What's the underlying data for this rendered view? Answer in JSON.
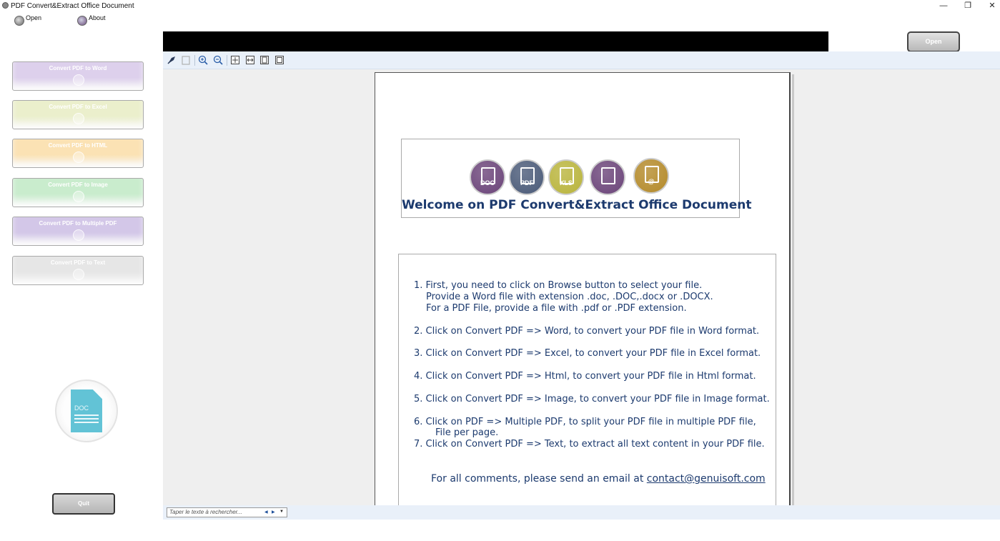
{
  "window": {
    "title": "PDF Convert&Extract Office Document",
    "minimize_glyph": "—",
    "restore_glyph": "❐",
    "close_glyph": "✕"
  },
  "menu": {
    "open_label": "Open",
    "about_label": "About"
  },
  "sidebar": {
    "buttons": [
      {
        "label": "Convert PDF to Word",
        "color": "#ddd0ec"
      },
      {
        "label": "Convert PDF to Excel",
        "color": "#ebefcc"
      },
      {
        "label": "Convert PDF to HTML",
        "color": "#fbe2b4"
      },
      {
        "label": "Convert PDF to Image",
        "color": "#c9eccd"
      },
      {
        "label": "Convert PDF to Multiple PDF",
        "color": "#d3c7e8"
      },
      {
        "label": "Convert PDF to Text",
        "color": "#e6e6e6"
      }
    ],
    "doc_badge_text": "DOC",
    "quit_label": "Quit"
  },
  "topbar": {
    "open_button_label": "Open"
  },
  "toolbar": {
    "icons": [
      "hand-tool-icon",
      "select-text-icon",
      "zoom-in-icon",
      "zoom-out-icon",
      "fit-page-icon",
      "fit-width-icon",
      "single-page-icon",
      "continuous-page-icon"
    ]
  },
  "document": {
    "logos": [
      {
        "label": "DOC",
        "color": "#6b4479"
      },
      {
        "label": "PDF",
        "color": "#4a5a78"
      },
      {
        "label": "XLS",
        "color": "#b9b43c"
      },
      {
        "label": "",
        "color": "#6b4479"
      },
      {
        "label": "@",
        "color": "#b48a2a"
      }
    ],
    "welcome_title": "Welcome on PDF Convert&Extract Office Document",
    "instructions": {
      "step1_line1": "1.  First, you need to click on Browse button to select your file.",
      "step1_line2": "Provide a Word file with extension .doc, .DOC,.docx or .DOCX.",
      "step1_line3": "For a PDF File, provide a file with .pdf or .PDF extension.",
      "step2": "2.    Click on Convert PDF => Word, to convert your PDF file in Word format.",
      "step3": "3.    Click on Convert PDF => Excel, to convert your PDF file in Excel format.",
      "step4": "4.    Click on Convert PDF => Html, to convert your PDF file in Html format.",
      "step5": "5.    Click on Convert PDF => Image, to convert your PDF file in Image format.",
      "step6_line1": "6.    Click on  PDF => Multiple PDF, to split your PDF file in multiple PDF file,",
      "step6_line2": "File per page.",
      "step7": "7.    Click on Convert PDF => Text, to extract all text content in your PDF file.",
      "comments_prefix": "For all comments, please send an email at ",
      "email": "contact@genuisoft.com"
    }
  },
  "search": {
    "placeholder": "Taper le texte à rechercher...",
    "prev_glyph": "◀",
    "next_glyph": "▶",
    "options_glyph": "▼"
  }
}
